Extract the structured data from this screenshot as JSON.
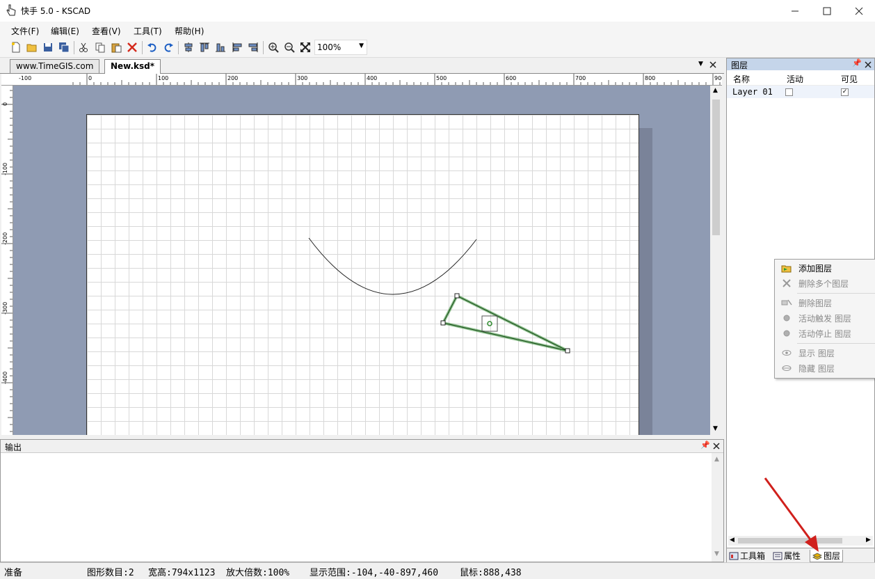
{
  "window": {
    "title": "快手 5.0 - KSCAD"
  },
  "menu": [
    "文件(F)",
    "编辑(E)",
    "查看(V)",
    "工具(T)",
    "帮助(H)"
  ],
  "toolbar": {
    "zoom_value": "100%"
  },
  "tabs": [
    {
      "label": "www.TimeGIS.com"
    },
    {
      "label": "New.ksd*"
    }
  ],
  "ruler": {
    "h_labels": [
      "-100",
      "0",
      "100",
      "200",
      "300",
      "400",
      "500",
      "600",
      "700",
      "800",
      "900"
    ],
    "v_labels": [
      "0",
      "-100",
      "-200",
      "-300",
      "-400"
    ]
  },
  "output": {
    "title": "输出"
  },
  "layers": {
    "title": "图层",
    "columns": {
      "name": "名称",
      "active": "活动",
      "visible": "可见"
    },
    "rows": [
      {
        "name": "Layer 01",
        "active": false,
        "visible": true
      }
    ]
  },
  "panel_tabs": [
    "工具箱",
    "属性",
    "图层"
  ],
  "context_menu": {
    "items": [
      {
        "label": "添加图层",
        "enabled": true,
        "icon": "add-layer-icon"
      },
      {
        "label": "删除多个图层",
        "enabled": false,
        "icon": "delete-multi-icon"
      },
      {
        "label": "删除图层",
        "enabled": false,
        "icon": "delete-layer-icon"
      },
      {
        "label": "活动触发 图层",
        "enabled": false,
        "icon": "activate-icon"
      },
      {
        "label": "活动停止 图层",
        "enabled": false,
        "icon": "deactivate-icon"
      },
      {
        "label": "显示 图层",
        "enabled": false,
        "icon": "show-icon"
      },
      {
        "label": "隐藏 图层",
        "enabled": false,
        "icon": "hide-icon"
      }
    ]
  },
  "status": {
    "ready": "准备",
    "count": "图形数目:2",
    "size": "宽高:794x1123",
    "zoom": "放大倍数:100%",
    "range": "显示范围:-104,-40-897,460",
    "mouse": "鼠标:888,438"
  },
  "colors": {
    "canvas_bg": "#8f9bb3",
    "selection": "#2e8b2e",
    "panel_header": "#c5d5ea",
    "arrow": "#d0201c"
  }
}
